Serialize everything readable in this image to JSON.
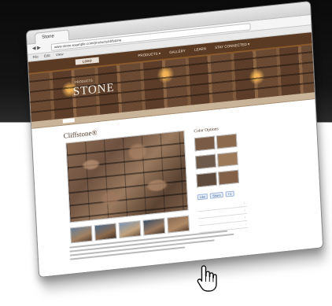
{
  "browser": {
    "tab_title": "Stone",
    "url": "www.stone.example.com/products/clifstone",
    "menu": [
      "File",
      "Edit",
      "View"
    ],
    "nav_buttons": "◀ ▶"
  },
  "site": {
    "logo": "LOGO",
    "nav": [
      "PRODUCTS ▾",
      "GALLERY",
      "LEARN",
      "STAY CONNECTED ▾"
    ],
    "hero_kicker": "PRODUCTS",
    "hero_title": "STONE",
    "subnav": [
      "",
      "",
      "",
      ""
    ]
  },
  "product": {
    "title": "Cliffstone®",
    "photo_caption": "",
    "thumbnails": 5
  },
  "sidebar": {
    "title": "Color Options",
    "swatches": [
      {
        "label": "",
        "color": "#7a5b45"
      },
      {
        "label": "",
        "color": "#8b6a4d"
      },
      {
        "label": "",
        "color": "#6d5a4a"
      },
      {
        "label": "",
        "color": "#9c7a5a"
      },
      {
        "label": "",
        "color": "#5e4b3c"
      },
      {
        "label": "",
        "color": "#826148"
      }
    ],
    "share": [
      "Like",
      "Share",
      "+1"
    ],
    "links": [
      "",
      "",
      "",
      ""
    ]
  },
  "colors": {
    "brand_brown": "#5a3a22",
    "accent_tan": "#c9b399"
  }
}
